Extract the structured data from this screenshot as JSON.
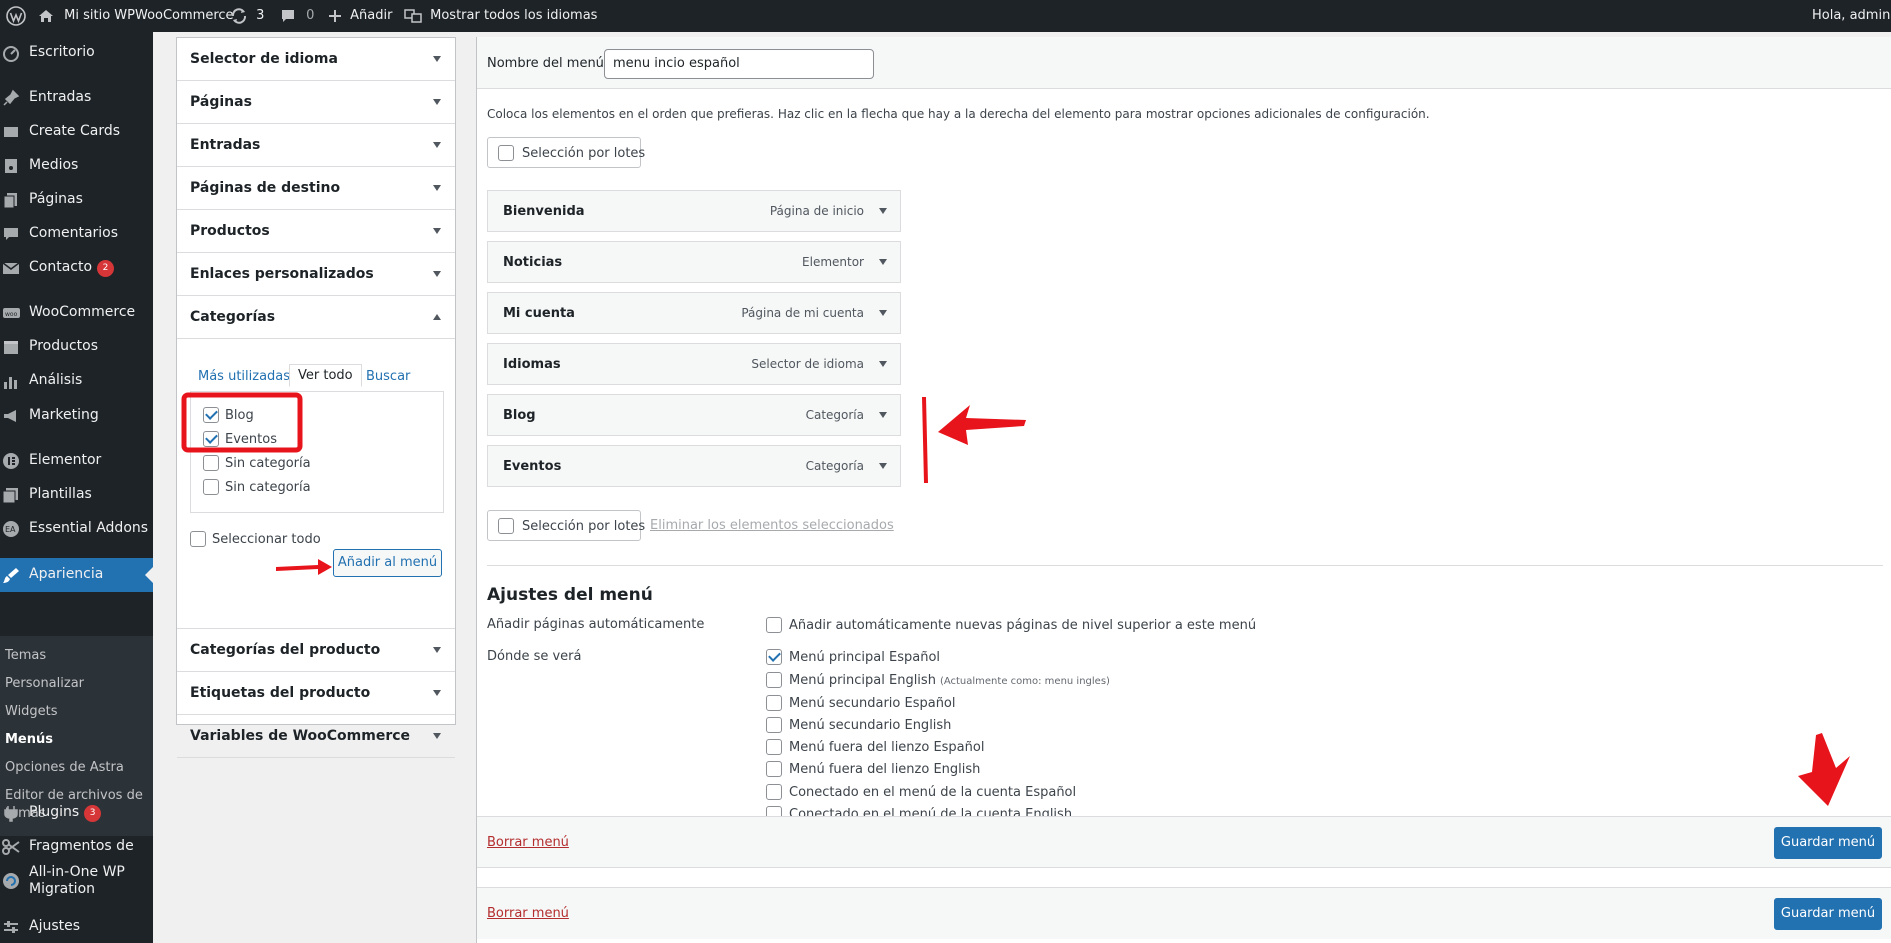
{
  "adminbar": {
    "site_name": "Mi sitio WPWooCommerce",
    "updates_count": "3",
    "comments_count": "0",
    "new_label": "Añadir",
    "languages_label": "Mostrar todos los idiomas",
    "greeting": "Hola, admin"
  },
  "sidebar": {
    "items": [
      {
        "label": "Escritorio",
        "icon": "dashboard-icon"
      },
      {
        "label": "Entradas",
        "icon": "pin-icon"
      },
      {
        "label": "Create Cards",
        "icon": "cards-icon"
      },
      {
        "label": "Medios",
        "icon": "media-icon"
      },
      {
        "label": "Páginas",
        "icon": "pages-icon"
      },
      {
        "label": "Comentarios",
        "icon": "comments-icon"
      },
      {
        "label": "Contacto",
        "icon": "mail-icon",
        "badge": "2"
      },
      {
        "label": "WooCommerce",
        "icon": "woo-icon"
      },
      {
        "label": "Productos",
        "icon": "products-icon"
      },
      {
        "label": "Análisis",
        "icon": "analytics-icon"
      },
      {
        "label": "Marketing",
        "icon": "megaphone-icon"
      },
      {
        "label": "Elementor",
        "icon": "elementor-icon"
      },
      {
        "label": "Plantillas",
        "icon": "templates-icon"
      },
      {
        "label": "Essential Addons",
        "icon": "ea-icon"
      },
      {
        "label": "Apariencia",
        "icon": "brush-icon"
      },
      {
        "label": "Plugins",
        "icon": "plugin-icon",
        "badge": "3"
      },
      {
        "label": "Fragmentos de",
        "icon": "scissors-icon"
      },
      {
        "label": "All-in-One WP",
        "label2": "Migration",
        "icon": "migration-icon"
      },
      {
        "label": "Ajustes",
        "icon": "settings-icon"
      }
    ],
    "submenu": [
      "Temas",
      "Personalizar",
      "Widgets",
      "Menús",
      "Opciones de Astra",
      "Editor de archivos de",
      "temas"
    ]
  },
  "accordion": {
    "sections_top": [
      "Selector de idioma",
      "Páginas",
      "Entradas",
      "Páginas de destino",
      "Productos",
      "Enlaces personalizados",
      "Categorías"
    ],
    "sections_bottom": [
      "Categorías del producto",
      "Etiquetas del producto",
      "Variables de WooCommerce"
    ],
    "tabs": [
      "Más utilizadas",
      "Ver todo",
      "Buscar"
    ],
    "categories": [
      {
        "label": "Blog",
        "checked": true
      },
      {
        "label": "Eventos",
        "checked": true
      },
      {
        "label": "Sin categoría",
        "checked": false
      },
      {
        "label": "Sin categoría",
        "checked": false
      }
    ],
    "select_all": "Seleccionar todo",
    "add_button": "Añadir al menú"
  },
  "main": {
    "menu_name_label": "Nombre del menú",
    "menu_name_value": "menu incio español",
    "instructions": "Coloca los elementos en el orden que prefieras. Haz clic en la flecha que hay a la derecha del elemento para mostrar opciones adicionales de configuración.",
    "bulk_select": "Selección por lotes",
    "remove_selected": "Eliminar los elementos seleccionados",
    "menu_items": [
      {
        "title": "Bienvenida",
        "type": "Página de inicio"
      },
      {
        "title": "Noticias",
        "type": "Elementor"
      },
      {
        "title": "Mi cuenta",
        "type": "Página de mi cuenta"
      },
      {
        "title": "Idiomas",
        "type": "Selector de idioma"
      },
      {
        "title": "Blog",
        "type": "Categoría"
      },
      {
        "title": "Eventos",
        "type": "Categoría"
      }
    ],
    "settings_title": "Ajustes del menú",
    "auto_add_label": "Añadir páginas automáticamente",
    "auto_add_option": "Añadir automáticamente nuevas páginas de nivel superior a este menú",
    "display_label": "Dónde se verá",
    "locations": [
      {
        "label": "Menú principal Español",
        "note": "",
        "checked": true
      },
      {
        "label": "Menú principal English",
        "note": "(Actualmente como: menu ingles)",
        "checked": false
      },
      {
        "label": "Menú secundario Español",
        "note": "",
        "checked": false
      },
      {
        "label": "Menú secundario English",
        "note": "",
        "checked": false
      },
      {
        "label": "Menú fuera del lienzo Español",
        "note": "",
        "checked": false
      },
      {
        "label": "Menú fuera del lienzo English",
        "note": "",
        "checked": false
      },
      {
        "label": "Conectado en el menú de la cuenta Español",
        "note": "",
        "checked": false
      },
      {
        "label": "Conectado en el menú de la cuenta English",
        "note": "",
        "checked": false
      }
    ],
    "delete_menu": "Borrar menú",
    "save_menu": "Guardar menú"
  },
  "colors": {
    "annotation": "#e8141b",
    "accent": "#2271b1",
    "adminbar": "#1d2327"
  }
}
